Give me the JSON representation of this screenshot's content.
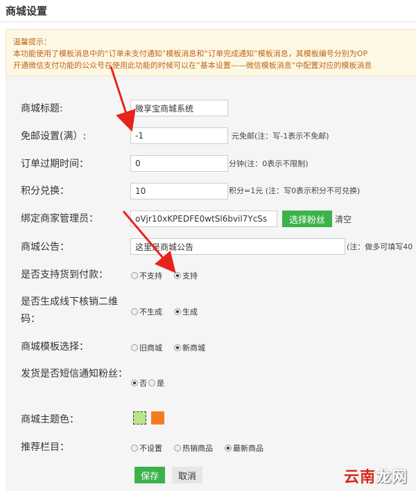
{
  "page": {
    "title": "商城设置"
  },
  "notice": {
    "heading": "温馨提示：",
    "line1": "本功能使用了模板消息中的“订单未支付通知”模板消息和“订单完成通知”模板消息，其模板编号分别为OP",
    "line2": "开通微信支付功能的公众号在使用此功能的时候可以在”基本设置——微信模板消息“中配置对应的模板消息"
  },
  "form": {
    "shop_title": {
      "label": "商城标题:",
      "value": "微享宝商城系统"
    },
    "free_shipping": {
      "label": "免邮设置(满）:",
      "value": "-1",
      "note": "元免邮(注：写-1表示不免邮)"
    },
    "order_expire": {
      "label": "订单过期时间：",
      "value": "0",
      "note": "分钟(注：0表示不限制)"
    },
    "points": {
      "label": "积分兑换：",
      "value": "10",
      "note": "积分=1元 (注：写0表示积分不可兑换)"
    },
    "bind_admin": {
      "label": "绑定商家管理员：",
      "value": "oVjr10xKPEDFE0wtSl6bvil7YcSs",
      "select_btn": "选择粉丝",
      "clear_link": "清空"
    },
    "announcement": {
      "label": "商城公告：",
      "value": "这里是商城公告",
      "note": "(注：做多可填写40"
    },
    "cod": {
      "label": "是否支持货到付款：",
      "options": [
        "不支持",
        "支持"
      ],
      "selected": 1
    },
    "qrcode": {
      "label": "是否生成线下核销二维码：",
      "options": [
        "不生成",
        "生成"
      ],
      "selected": 1
    },
    "template": {
      "label": "商城模板选择：",
      "options": [
        "旧商城",
        "新商城"
      ],
      "selected": 1
    },
    "sms_notify": {
      "label": "发货是否短信通知粉丝：",
      "options": [
        "否",
        "是"
      ],
      "selected": 0
    },
    "theme_color": {
      "label": "商城主题色：",
      "colors": [
        "#b8e68a",
        "#f47c20"
      ],
      "selected": 0
    },
    "recommend": {
      "label": "推荐栏目：",
      "options": [
        "不设置",
        "热销商品",
        "最新商品"
      ],
      "selected": 2
    }
  },
  "actions": {
    "save": "保存",
    "cancel": "取消"
  },
  "watermark": {
    "part1": "云南",
    "part2": "龙网"
  },
  "colors": {
    "accent_green": "#3cb24a",
    "arrow_red": "#e8231c",
    "notice_text": "#c0651a"
  }
}
